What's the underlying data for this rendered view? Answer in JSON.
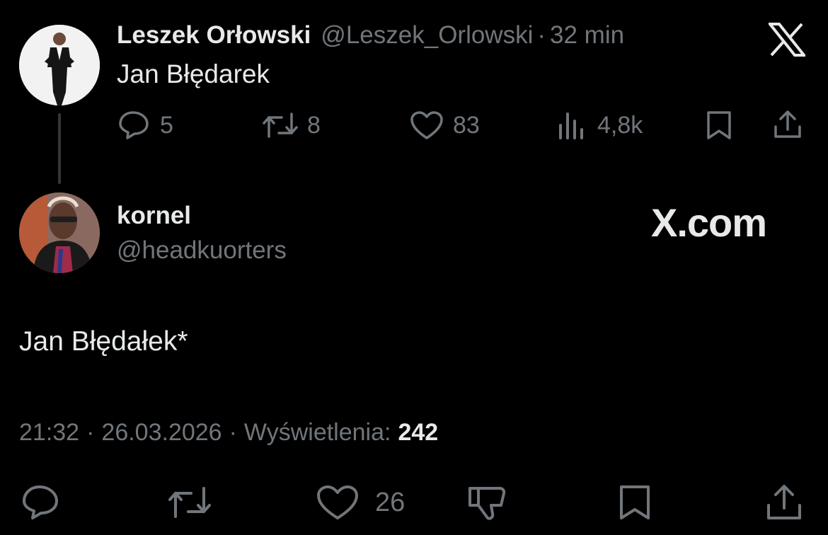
{
  "quoted_tweet": {
    "author_name": "Leszek Orłowski",
    "author_handle": "@Leszek_Orlowski",
    "separator": "·",
    "time_ago": "32 min",
    "text": "Jan Błędarek",
    "replies": "5",
    "reposts": "8",
    "likes": "83",
    "views": "4,8k"
  },
  "reply_tweet": {
    "author_name": "kornel",
    "author_handle": "@headkuorters",
    "text": "Jan Błędałek*",
    "time": "21:32",
    "dot1": "·",
    "date": "26.03.2026",
    "dot2": "·",
    "views_label": "Wyświetlenia:",
    "views_value": "242",
    "likes": "26"
  },
  "brand": {
    "logo_text": "X.com"
  },
  "colors": {
    "background": "#000000",
    "text": "#e7e9ea",
    "muted": "#71767b"
  }
}
